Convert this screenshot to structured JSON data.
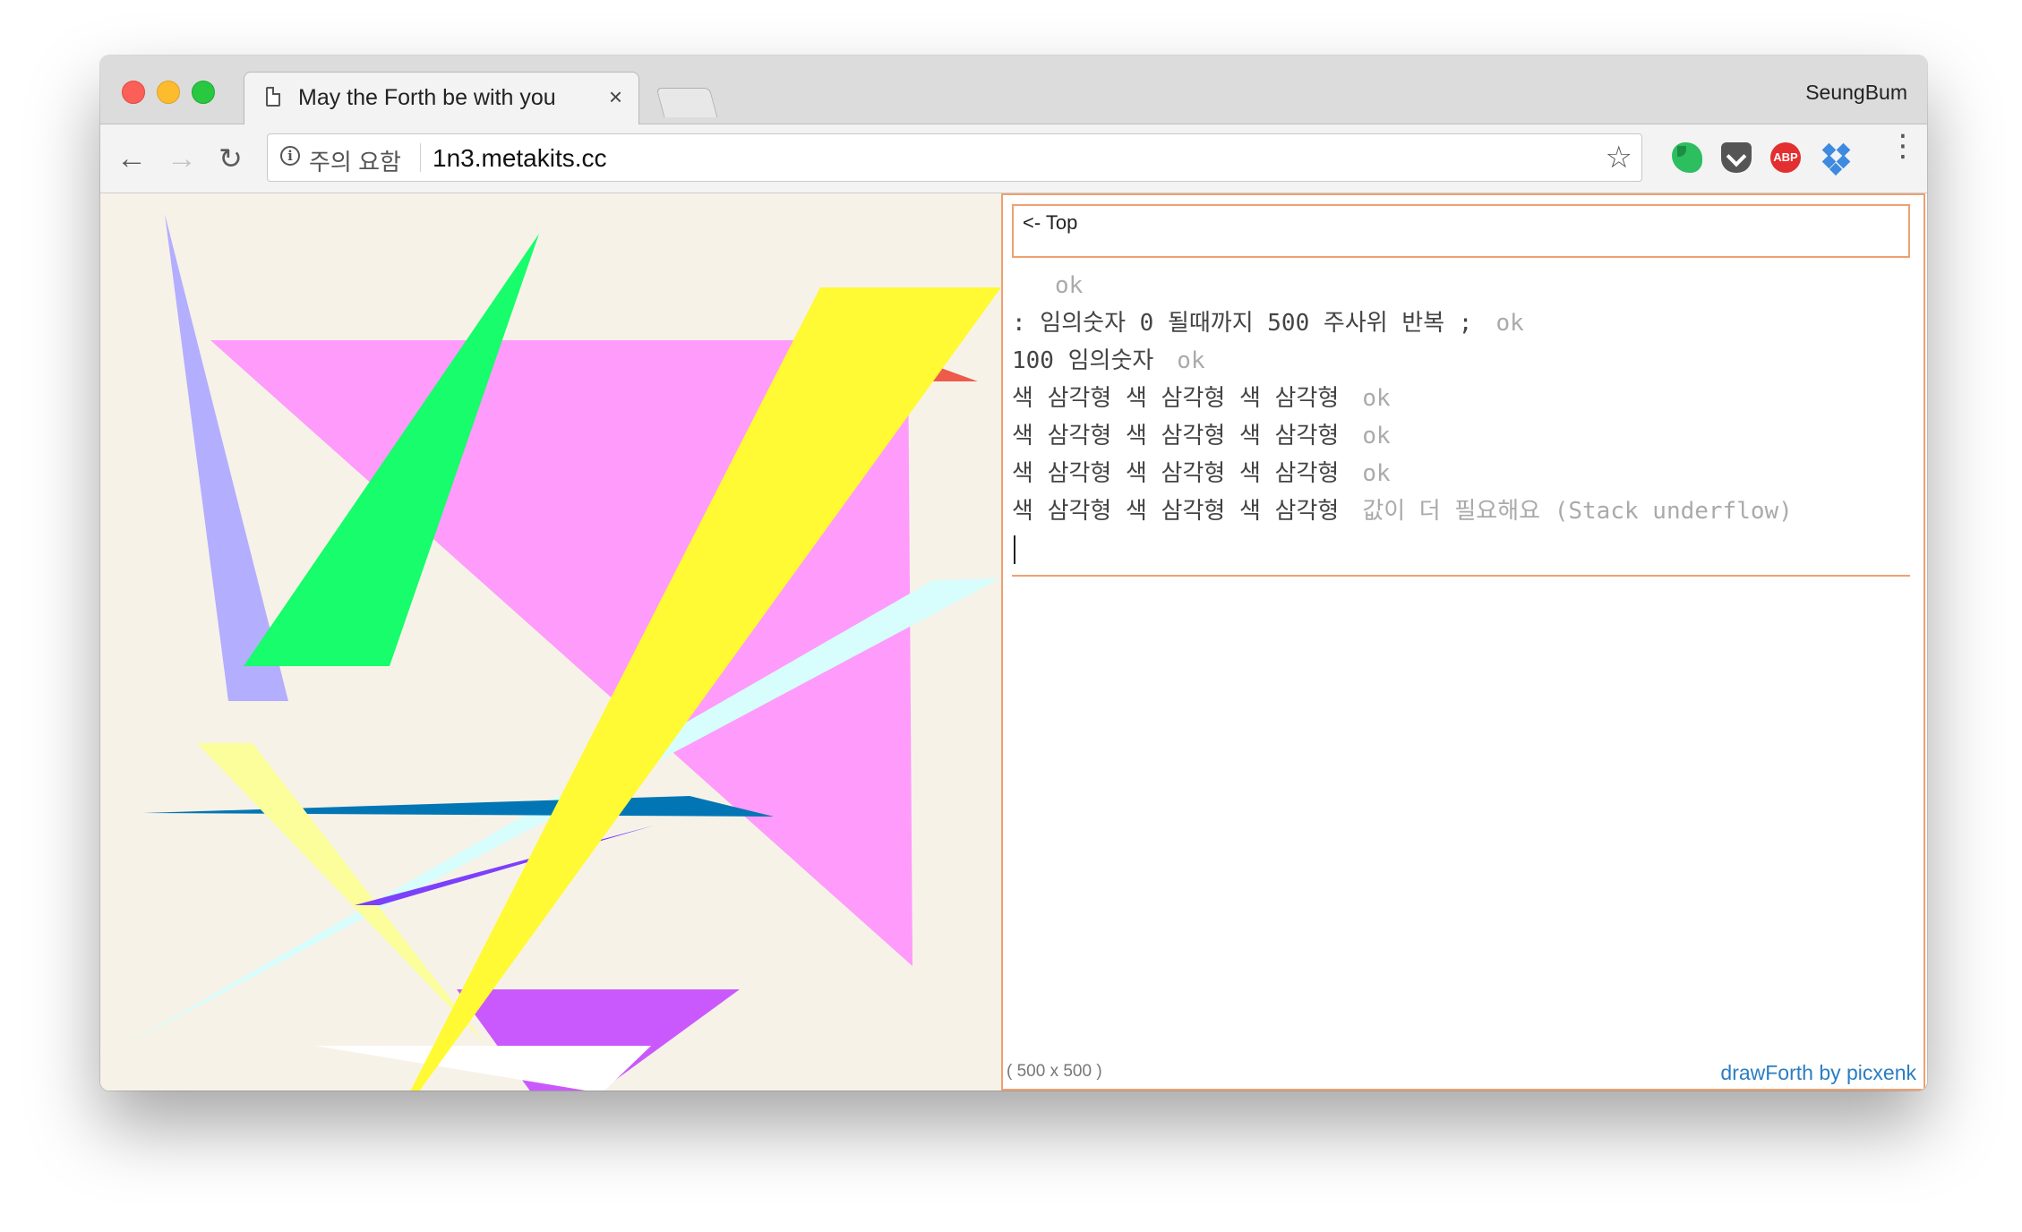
{
  "browser": {
    "tab_title": "May the Forth be with you",
    "tab_close": "×",
    "profile_name": "SeungBum",
    "security_text": "주의 요함",
    "url": "1n3.metakits.cc",
    "back": "←",
    "forward": "→",
    "reload": "↻",
    "star": "☆",
    "abp_label": "ABP",
    "menu": "⋮",
    "extensions": [
      "evernote-icon",
      "pocket-icon",
      "adblock-plus-icon",
      "dropbox-icon"
    ]
  },
  "panel": {
    "top_link": "<- Top",
    "console_lines": [
      {
        "cmd": "",
        "resp": "ok"
      },
      {
        "cmd": ": 임의숫자 0 될때까지 500 주사위 반복 ;",
        "resp": "ok"
      },
      {
        "cmd": "100 임의숫자",
        "resp": "ok"
      },
      {
        "cmd": "색 삼각형 색 삼각형 색 삼각형",
        "resp": "ok"
      },
      {
        "cmd": "색 삼각형 색 삼각형 색 삼각형",
        "resp": "ok"
      },
      {
        "cmd": "색 삼각형 색 삼각형 색 삼각형",
        "resp": "ok"
      },
      {
        "cmd": "색 삼각형 색 삼각형 색 삼각형",
        "resp": "값이 더 필요해요 (Stack underflow)"
      }
    ],
    "canvas_size": "( 500 x 500 )",
    "credit": "drawForth by picxenk"
  },
  "canvas": {
    "background": "#f7f2e8",
    "triangle_colors": [
      "#b3aefe",
      "#fe9bfb",
      "#ed5b4a",
      "#17fd6b",
      "#d7fefc",
      "#0276b5",
      "#fbfe9b",
      "#7c40fa",
      "#ca59fd",
      "#ffffff",
      "#fffa33"
    ]
  }
}
